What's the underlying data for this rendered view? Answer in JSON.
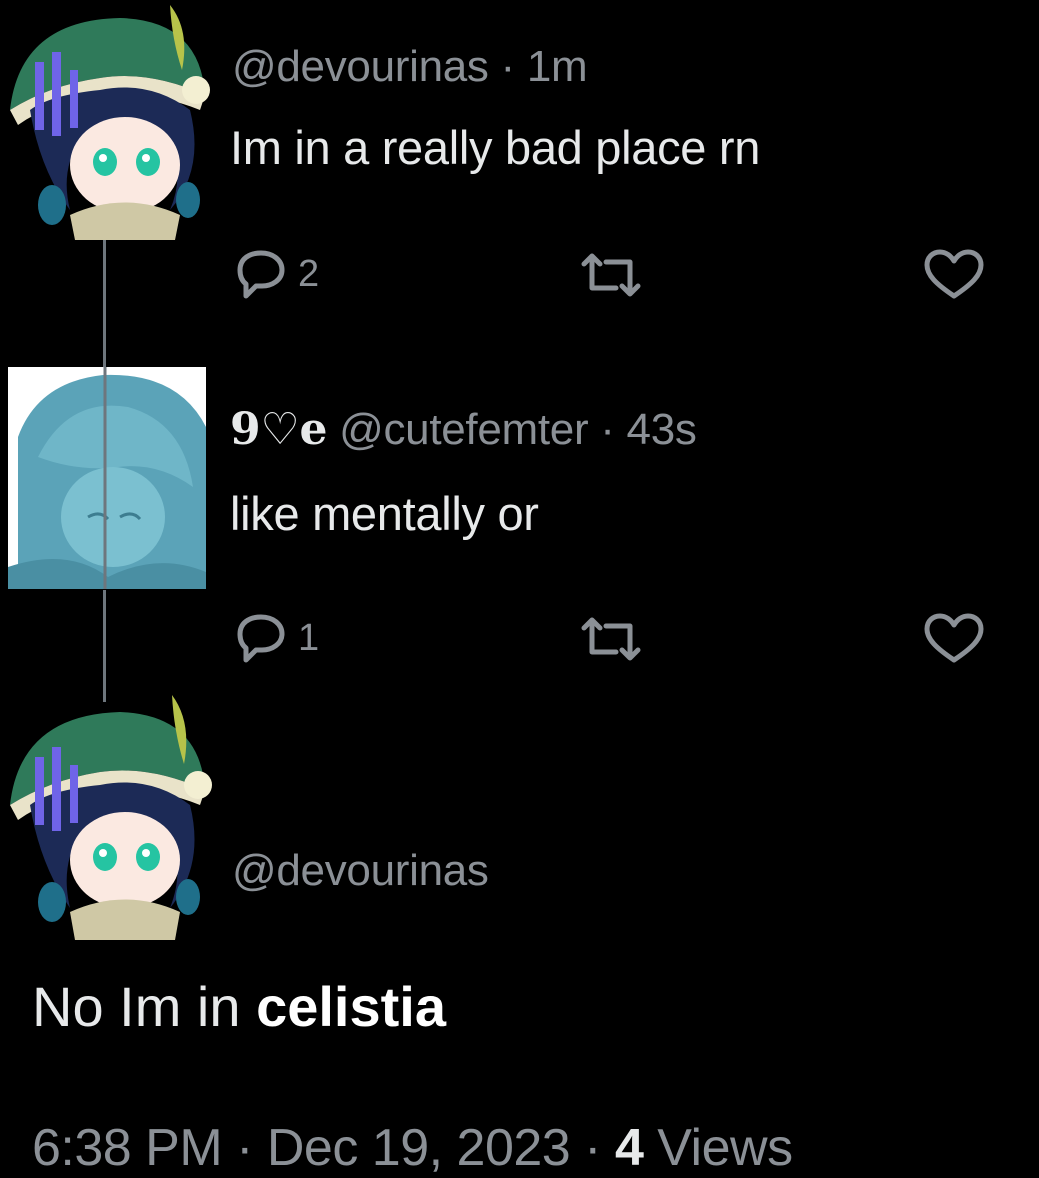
{
  "tweets": [
    {
      "handle": "@devourinas",
      "separator": " · ",
      "time": "1m",
      "text": "Im in a really bad place rn",
      "reply_count": "2",
      "avatar_icon": "chibi-character-green-hat-avatar"
    },
    {
      "display_name": "9♡e",
      "handle": "@cutefemter",
      "separator": " · ",
      "time": "43s",
      "text": "like mentally or",
      "reply_count": "1",
      "avatar_icon": "blue-tinted-character-avatar"
    }
  ],
  "main": {
    "handle": "@devourinas",
    "text_prefix": "No Im in ",
    "text_bold": "celistia",
    "footer_time": "6:38 PM",
    "footer_sep1": " · ",
    "footer_date": "Dec 19, 2023",
    "footer_sep2": " · ",
    "views_count": "4",
    "views_label": " Views"
  },
  "colors": {
    "background": "#000000",
    "text": "#e7e9ea",
    "muted": "#8b9096",
    "thread_line": "#6e767d"
  }
}
